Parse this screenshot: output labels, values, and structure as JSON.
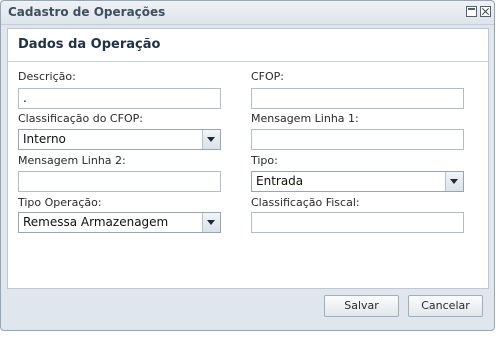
{
  "window": {
    "title": "Cadastro de Operações"
  },
  "form": {
    "section_title": "Dados da Operação",
    "descricao": {
      "label": "Descrição:",
      "value": "."
    },
    "cfop": {
      "label": "CFOP:",
      "value": ""
    },
    "classificacao_cfop": {
      "label": "Classificação do CFOP:",
      "value": "Interno"
    },
    "mensagem_linha_1": {
      "label": "Mensagem Linha 1:",
      "value": ""
    },
    "mensagem_linha_2": {
      "label": "Mensagem Linha 2:",
      "value": ""
    },
    "tipo": {
      "label": "Tipo:",
      "value": "Entrada"
    },
    "tipo_operacao": {
      "label": "Tipo Operação:",
      "value": "Remessa Armazenagem"
    },
    "classificacao_fiscal": {
      "label": "Classificação Fiscal:",
      "value": ""
    }
  },
  "actions": {
    "save_label": "Salvar",
    "cancel_label": "Cancelar"
  }
}
